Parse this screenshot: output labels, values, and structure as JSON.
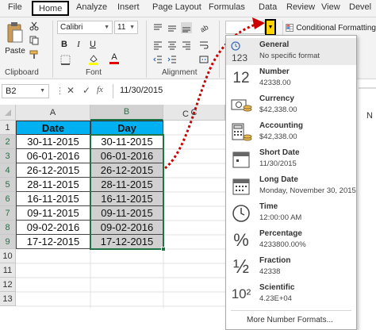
{
  "menu": {
    "tabs": [
      "File",
      "Home",
      "Analyze",
      "Insert",
      "Page Layout",
      "Formulas",
      "Data",
      "Review",
      "View",
      "Devel"
    ],
    "active": "Home"
  },
  "ribbon": {
    "paste_label": "Paste",
    "clipboard_label": "Clipboard",
    "font_name": "Calibri",
    "font_size": "11",
    "font_group_label": "Font",
    "alignment_group_label": "Alignment",
    "bold": "B",
    "italic": "I",
    "underline": "U",
    "font_color_glyph": "A",
    "conditional_formatting_label": "Conditional Formatting"
  },
  "formula_bar": {
    "name_box": "B2",
    "value": "11/30/2015"
  },
  "grid": {
    "columns": [
      "A",
      "B",
      "C"
    ],
    "rows": [
      "1",
      "2",
      "3",
      "4",
      "5",
      "6",
      "7",
      "8",
      "9",
      "10",
      "11",
      "12",
      "13"
    ],
    "header": {
      "a": "Date",
      "b": "Day"
    },
    "data": [
      {
        "a": "30-11-2015",
        "b": "30-11-2015"
      },
      {
        "a": "06-01-2016",
        "b": "06-01-2016"
      },
      {
        "a": "26-12-2015",
        "b": "26-12-2015"
      },
      {
        "a": "28-11-2015",
        "b": "28-11-2015"
      },
      {
        "a": "16-11-2015",
        "b": "16-11-2015"
      },
      {
        "a": "09-11-2015",
        "b": "09-11-2015"
      },
      {
        "a": "09-02-2016",
        "b": "09-02-2016"
      },
      {
        "a": "17-12-2015",
        "b": "17-12-2015"
      }
    ],
    "header_color": "#00b0f0",
    "selection_color": "#d0d0d0"
  },
  "number_format_menu": {
    "options": [
      {
        "name": "General",
        "example": "No specific format",
        "icon": "general-123-icon",
        "glyph": "123"
      },
      {
        "name": "Number",
        "example": "42338.00",
        "icon": "number-12-icon",
        "glyph": "12"
      },
      {
        "name": "Currency",
        "example": "$42,338.00",
        "icon": "currency-icon",
        "glyph": ""
      },
      {
        "name": "Accounting",
        "example": " $42,338.00",
        "icon": "accounting-icon",
        "glyph": ""
      },
      {
        "name": "Short Date",
        "example": "11/30/2015",
        "icon": "short-date-calendar-icon",
        "glyph": ""
      },
      {
        "name": "Long Date",
        "example": "Monday, November 30, 2015",
        "icon": "long-date-calendar-icon",
        "glyph": ""
      },
      {
        "name": "Time",
        "example": "12:00:00 AM",
        "icon": "clock-icon",
        "glyph": ""
      },
      {
        "name": "Percentage",
        "example": "4233800.00%",
        "icon": "percent-icon",
        "glyph": "%"
      },
      {
        "name": "Fraction",
        "example": "42338",
        "icon": "fraction-icon",
        "glyph": "½"
      },
      {
        "name": "Scientific",
        "example": "4.23E+04",
        "icon": "scientific-icon",
        "glyph": "10²"
      }
    ],
    "more_label": "More Number Formats..."
  },
  "side_labels": [
    "C",
    "N"
  ],
  "accent": {
    "annotation_red": "#cc0000",
    "excel_green": "#217346",
    "highlight_yellow": "#ffd400"
  }
}
